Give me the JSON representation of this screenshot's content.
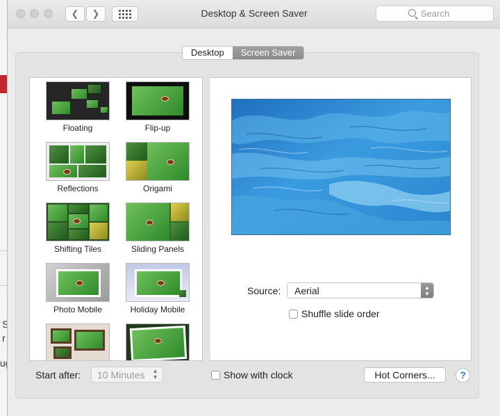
{
  "window": {
    "title": "Desktop & Screen Saver"
  },
  "toolbar": {
    "back_glyph": "❮",
    "forward_glyph": "❯",
    "search_placeholder": "Search"
  },
  "tabs": [
    {
      "label": "Desktop",
      "selected": false
    },
    {
      "label": "Screen Saver",
      "selected": true
    }
  ],
  "screensavers": [
    {
      "label": "Floating"
    },
    {
      "label": "Flip-up"
    },
    {
      "label": "Reflections"
    },
    {
      "label": "Origami"
    },
    {
      "label": "Shifting Tiles"
    },
    {
      "label": "Sliding Panels"
    },
    {
      "label": "Photo Mobile"
    },
    {
      "label": "Holiday Mobile"
    },
    {
      "label": ""
    },
    {
      "label": ""
    }
  ],
  "options": {
    "source_label": "Source:",
    "source_value": "Aerial",
    "shuffle_label": "Shuffle slide order",
    "shuffle_checked": false
  },
  "footer": {
    "start_after_label": "Start after:",
    "start_after_value": "10 Minutes",
    "show_clock_label": "Show with clock",
    "show_clock_checked": false,
    "hot_corners_label": "Hot Corners...",
    "help_glyph": "?"
  },
  "colors": {
    "accent": "#2f7ad8",
    "selected_tab": "#8e8e8e",
    "ocean": "#2f92d6"
  },
  "background_app": {
    "fragments": [
      "S",
      "r",
      "ug"
    ]
  }
}
